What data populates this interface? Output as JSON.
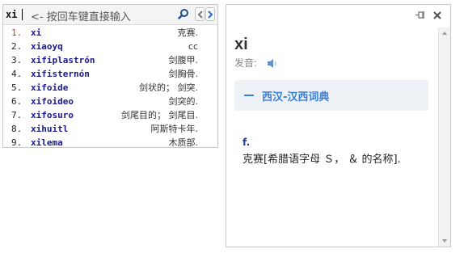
{
  "search": {
    "query": "xi",
    "hint": "<- 按回车键直接输入"
  },
  "suggestions": [
    {
      "num": "1.",
      "word": "xi",
      "def": "克赛."
    },
    {
      "num": "2.",
      "word": "xiaoyq",
      "def": "cc"
    },
    {
      "num": "3.",
      "word": "xifiplastrón",
      "def": "剑腹甲."
    },
    {
      "num": "4.",
      "word": "xifisternón",
      "def": "剑胸骨."
    },
    {
      "num": "5.",
      "word": "xifoide",
      "def": "剑状的； 剑突."
    },
    {
      "num": "6.",
      "word": "xifoideo",
      "def": "剑突的."
    },
    {
      "num": "7.",
      "word": "xifosuro",
      "def": "剑尾目的； 剑尾目."
    },
    {
      "num": "8.",
      "word": "xihuitl",
      "def": "阿斯特卡年."
    },
    {
      "num": "9.",
      "word": "xilema",
      "def": "木质部."
    }
  ],
  "entry": {
    "headword": "xi",
    "pron_label": "发音:",
    "dict_name": "西汉-汉西词典",
    "pos": "f.",
    "definition": "克赛[希腊语字母 Ｓ， ＆ 的名称]."
  },
  "icons": {
    "search": "search-icon",
    "prev": "chevron-left-icon",
    "next": "chevron-right-icon",
    "pin": "pin-icon",
    "close": "close-icon",
    "speaker": "speaker-icon"
  },
  "colors": {
    "accent": "#3a7fd6",
    "active_number": "#c0392b",
    "word": "#1a1a8c"
  }
}
